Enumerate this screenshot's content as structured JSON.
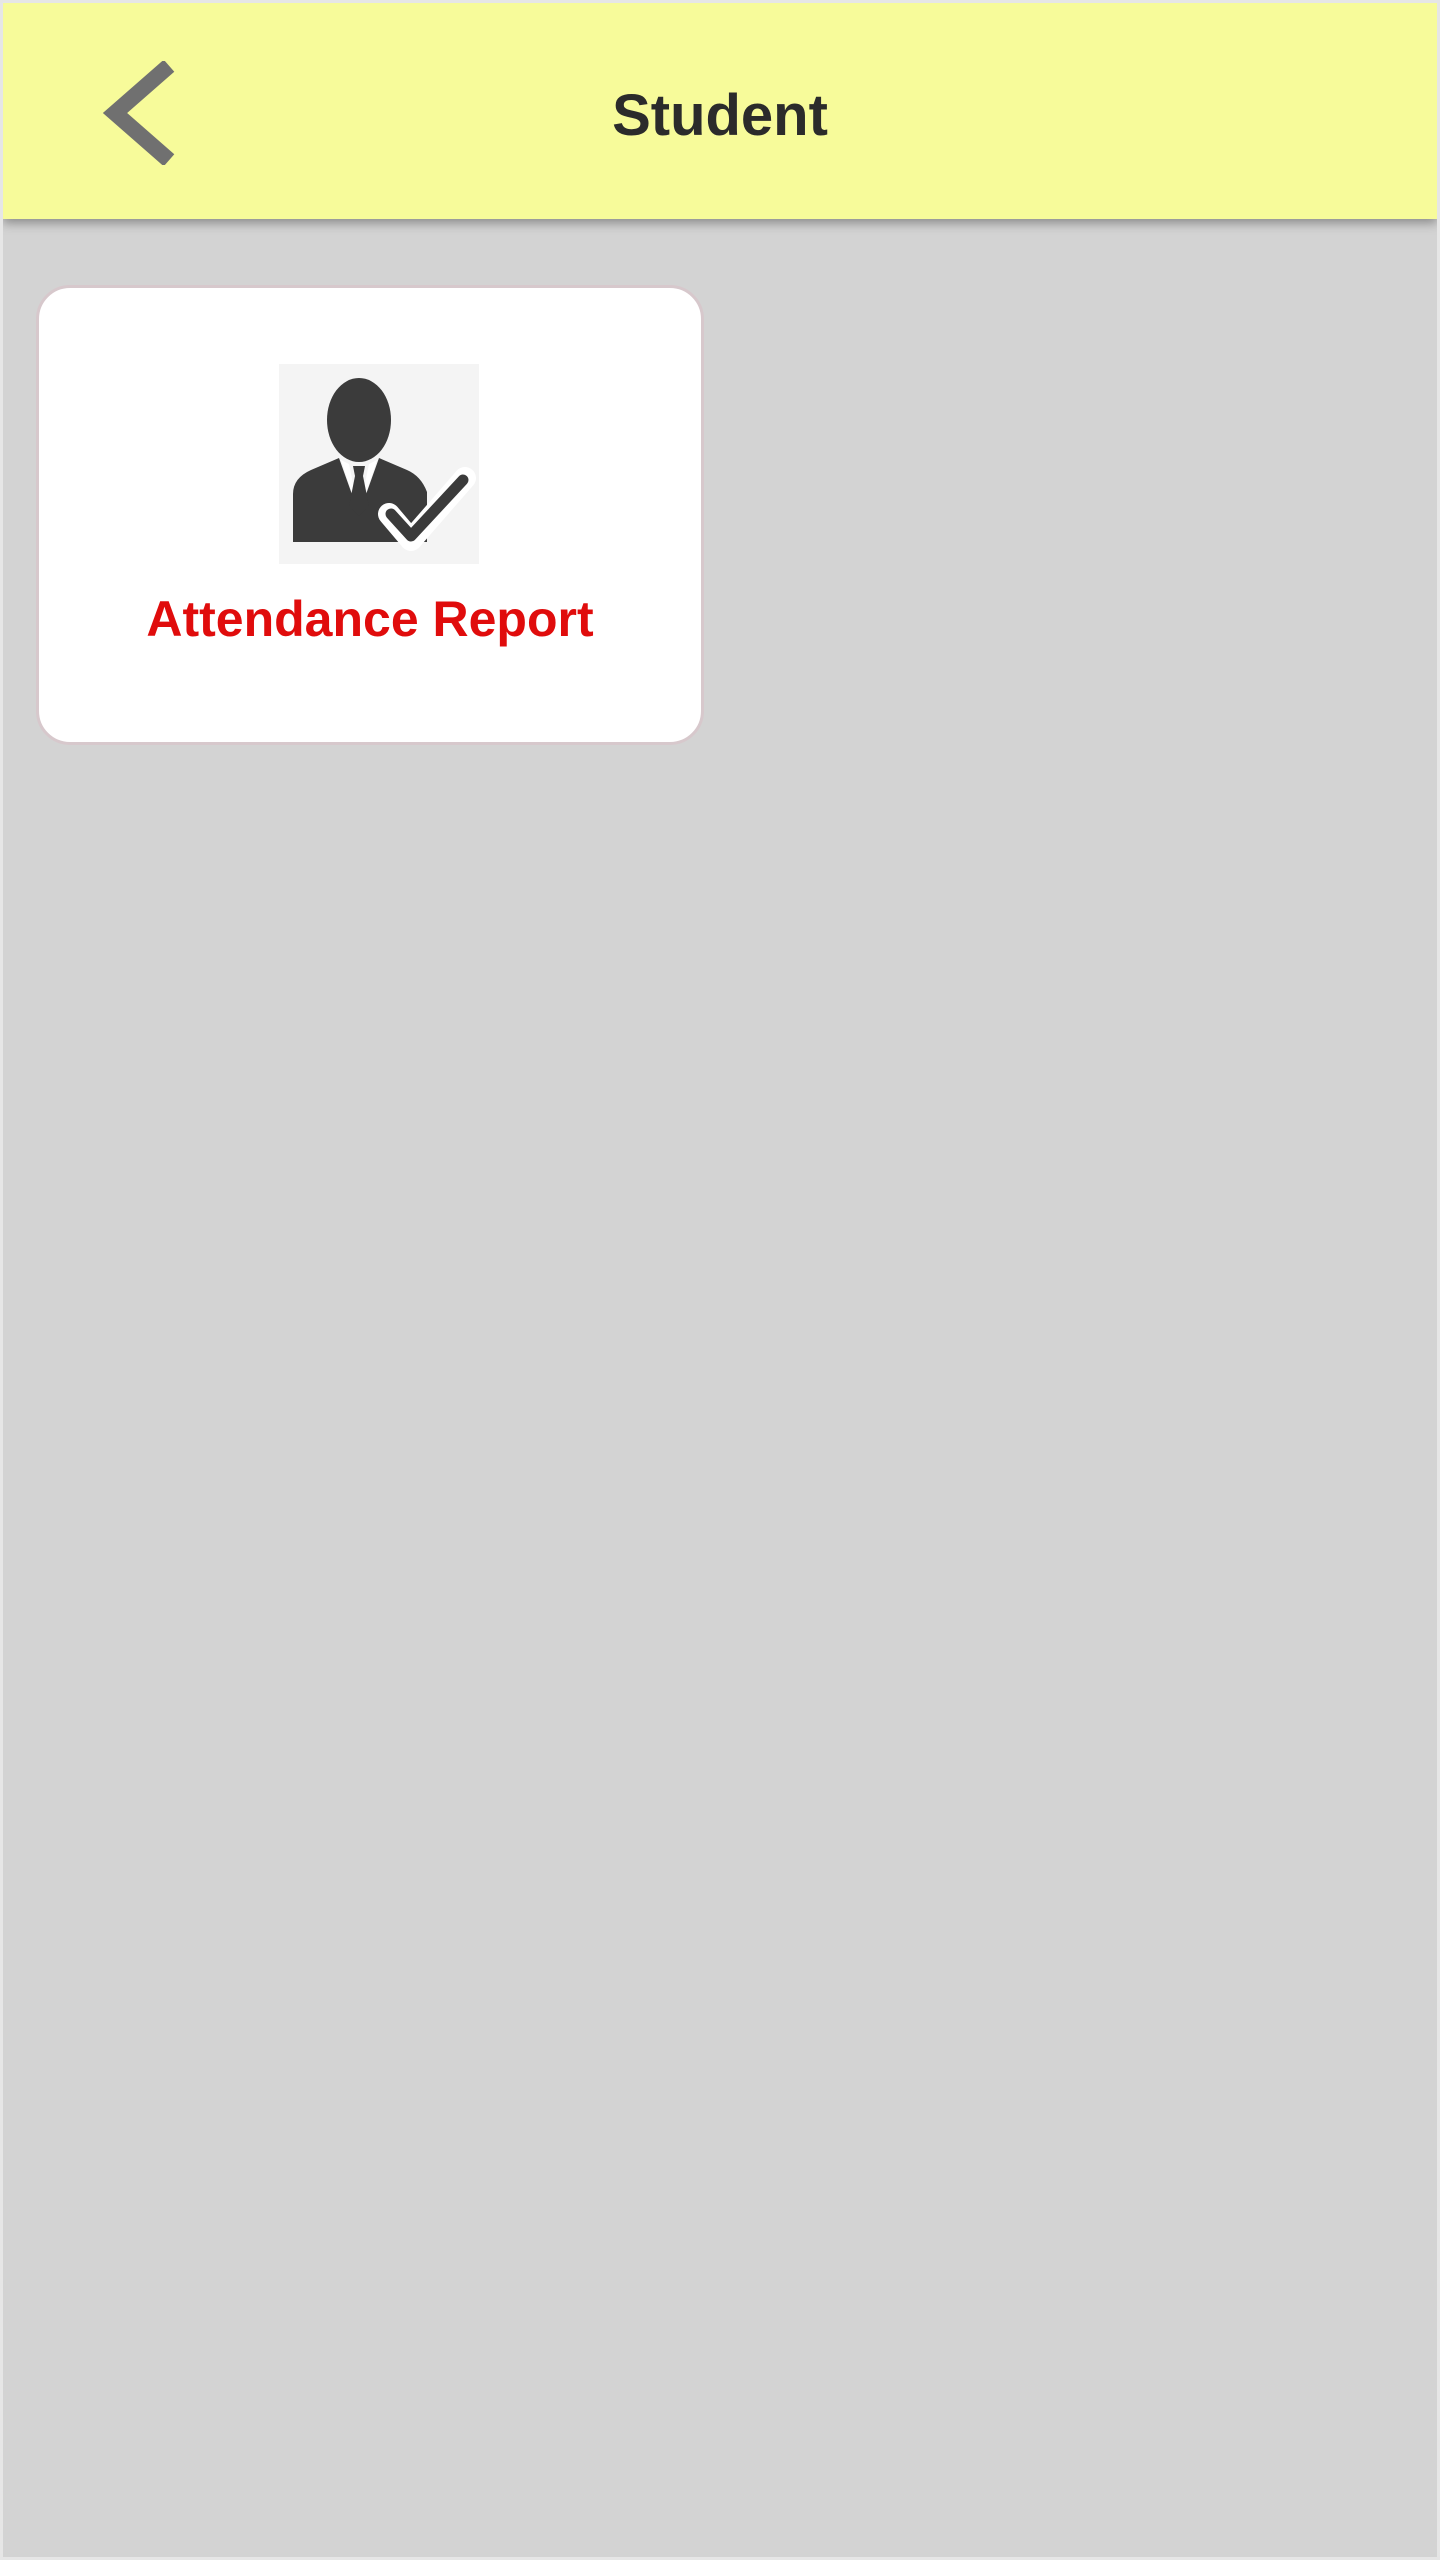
{
  "header": {
    "title": "Student",
    "back_icon": "chevron-left-icon",
    "background_color": "#f7fb9a"
  },
  "menu": {
    "items": [
      {
        "label": "Attendance Report",
        "icon": "user-check-icon",
        "label_color": "#e00c0c"
      }
    ]
  },
  "page": {
    "background_color": "#d3d3d3"
  }
}
